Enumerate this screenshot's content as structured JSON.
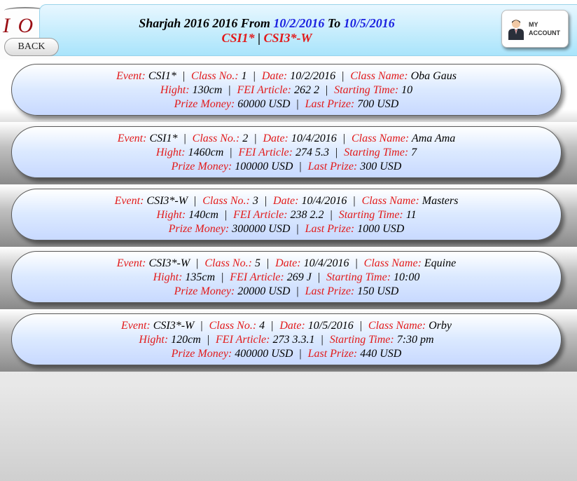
{
  "header": {
    "title_prefix": "Sharjah 2016 2016 From",
    "from_date": "10/2/2016",
    "to_word": "To",
    "to_date": "10/5/2016",
    "sub_left": "CSI1*",
    "sub_sep": "|",
    "sub_right": "CSI3*-W"
  },
  "back_label": "BACK",
  "account": {
    "line1": "MY",
    "line2": "ACCOUNT"
  },
  "labels": {
    "event": "Event:",
    "class_no": "Class No.:",
    "date": "Date:",
    "class_name": "Class Name:",
    "height": "Hight:",
    "fei": "FEI Article:",
    "start": "Starting Time:",
    "prize": "Prize Money:",
    "last_prize": "Last Prize:",
    "sep": "|"
  },
  "events": [
    {
      "event": "CSI1*",
      "class_no": "1",
      "date": "10/2/2016",
      "class_name": "Oba Gaus",
      "height": "130cm",
      "fei": "262 2",
      "start": "10",
      "prize": "60000 USD",
      "last_prize": "700 USD"
    },
    {
      "event": "CSI1*",
      "class_no": "2",
      "date": "10/4/2016",
      "class_name": "Ama Ama",
      "height": "1460cm",
      "fei": "274 5.3",
      "start": "7",
      "prize": "100000 USD",
      "last_prize": "300 USD"
    },
    {
      "event": "CSI3*-W",
      "class_no": "3",
      "date": "10/4/2016",
      "class_name": "Masters",
      "height": "140cm",
      "fei": "238 2.2",
      "start": "11",
      "prize": "300000 USD",
      "last_prize": "1000 USD"
    },
    {
      "event": "CSI3*-W",
      "class_no": "5",
      "date": "10/4/2016",
      "class_name": "Equine",
      "height": "135cm",
      "fei": "269 J",
      "start": "10:00",
      "prize": "20000 USD",
      "last_prize": "150 USD"
    },
    {
      "event": "CSI3*-W",
      "class_no": "4",
      "date": "10/5/2016",
      "class_name": "Orby",
      "height": "120cm",
      "fei": "273 3.3.1",
      "start": "7:30 pm",
      "prize": "400000 USD",
      "last_prize": "440 USD"
    }
  ]
}
